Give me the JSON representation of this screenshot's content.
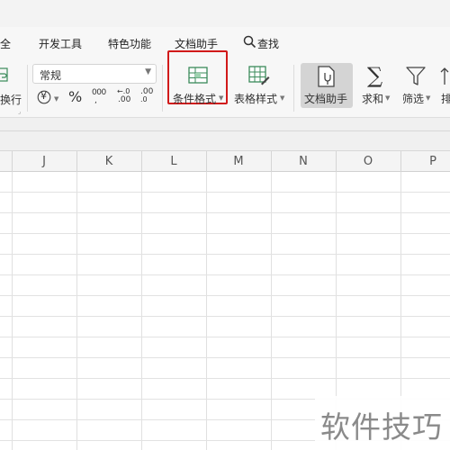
{
  "menu": {
    "items": [
      "全",
      "开发工具",
      "特色功能",
      "文档助手",
      "查找"
    ]
  },
  "ribbon": {
    "wrap_label": "换行",
    "number_format": "常规",
    "currency_symbol": "¥",
    "percent_symbol": "%",
    "thousands_symbol": "000",
    "inc_decimal": ".00",
    "dec_decimal": ".0",
    "conditional_format_label": "条件格式",
    "table_style_label": "表格样式",
    "doc_helper_label": "文档助手",
    "sum_label": "求和",
    "filter_label": "筛选",
    "sort_label": "排"
  },
  "sheet": {
    "columns": [
      "J",
      "K",
      "L",
      "M",
      "N",
      "O",
      "P"
    ]
  },
  "watermark": "软件技巧",
  "colors": {
    "highlight": "#d11a1a",
    "grid": "#e0e0e0"
  }
}
